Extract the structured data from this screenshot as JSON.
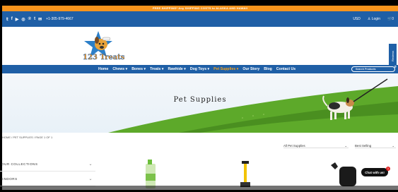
{
  "promo_text": "FREE SHIPPING* Any SHIPPING COSTS to ALASKA AND HAWAII",
  "topbar": {
    "social_icons": [
      "twitter-icon",
      "facebook-icon",
      "youtube-icon",
      "instagram-icon",
      "pinterest-icon",
      "tumblr-icon",
      "email-icon"
    ],
    "phone": "+1-305-979-4667",
    "currency": "USD",
    "login": "Login",
    "cart_count": "0"
  },
  "logo_text": "123 Treats",
  "reviews_label": "Reviews",
  "nav": {
    "items": [
      {
        "label": "Home"
      },
      {
        "label": "Chews ▾"
      },
      {
        "label": "Bones ▾"
      },
      {
        "label": "Treats ▾"
      },
      {
        "label": "Rawhide ▾"
      },
      {
        "label": "Dog Toys ▾"
      },
      {
        "label": "Pet Supplies ▾"
      },
      {
        "label": "Our Story"
      },
      {
        "label": "Blog"
      },
      {
        "label": "Contact Us"
      }
    ],
    "search_placeholder": "Search Products"
  },
  "hero": {
    "title": "Pet Supplies"
  },
  "breadcrumb": "HOME / PET SUPPLIES / PAGE 1 OF 1",
  "filters": {
    "category": "All Pet Supplies",
    "sort": "Best Selling"
  },
  "sidebar": {
    "items": [
      {
        "label": "OUR COLLECTIONS"
      },
      {
        "label": "ENDORS"
      }
    ]
  },
  "chat": {
    "label": "Chat with us!",
    "badge": "1"
  },
  "colors": {
    "brand_blue": "#1f5fa6",
    "promo_orange": "#f7941d",
    "nav_active": "#f7a31d",
    "grass_green": "#5da92a"
  }
}
